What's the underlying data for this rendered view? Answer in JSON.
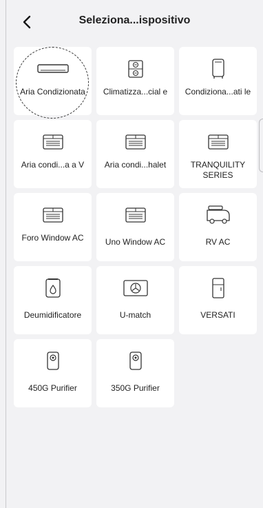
{
  "header": {
    "title": "Seleziona...ispositivo"
  },
  "tiles": [
    {
      "label": "Aria Condizionata",
      "icon": "split-ac-icon"
    },
    {
      "label": "Climatizza...cial e",
      "icon": "commercial-ac-icon"
    },
    {
      "label": "Condiziona...ati le",
      "icon": "portable-ac-icon"
    },
    {
      "label": "Aria condi...a a V",
      "icon": "window-unit-icon"
    },
    {
      "label": "Aria condi...halet",
      "icon": "window-unit-icon"
    },
    {
      "label": "TRANQUILITY SERIES",
      "icon": "window-unit-icon"
    },
    {
      "label": "Foro Window AC",
      "icon": "window-unit-icon"
    },
    {
      "label": "Uno Window AC",
      "icon": "window-unit-icon"
    },
    {
      "label": "RV AC",
      "icon": "rv-icon"
    },
    {
      "label": "Deumidificatore",
      "icon": "dehumidifier-icon"
    },
    {
      "label": "U-match",
      "icon": "u-match-icon"
    },
    {
      "label": "VERSATI",
      "icon": "fridge-icon"
    },
    {
      "label": "450G Purifier",
      "icon": "purifier-icon"
    },
    {
      "label": "350G Purifier",
      "icon": "purifier-icon"
    }
  ]
}
